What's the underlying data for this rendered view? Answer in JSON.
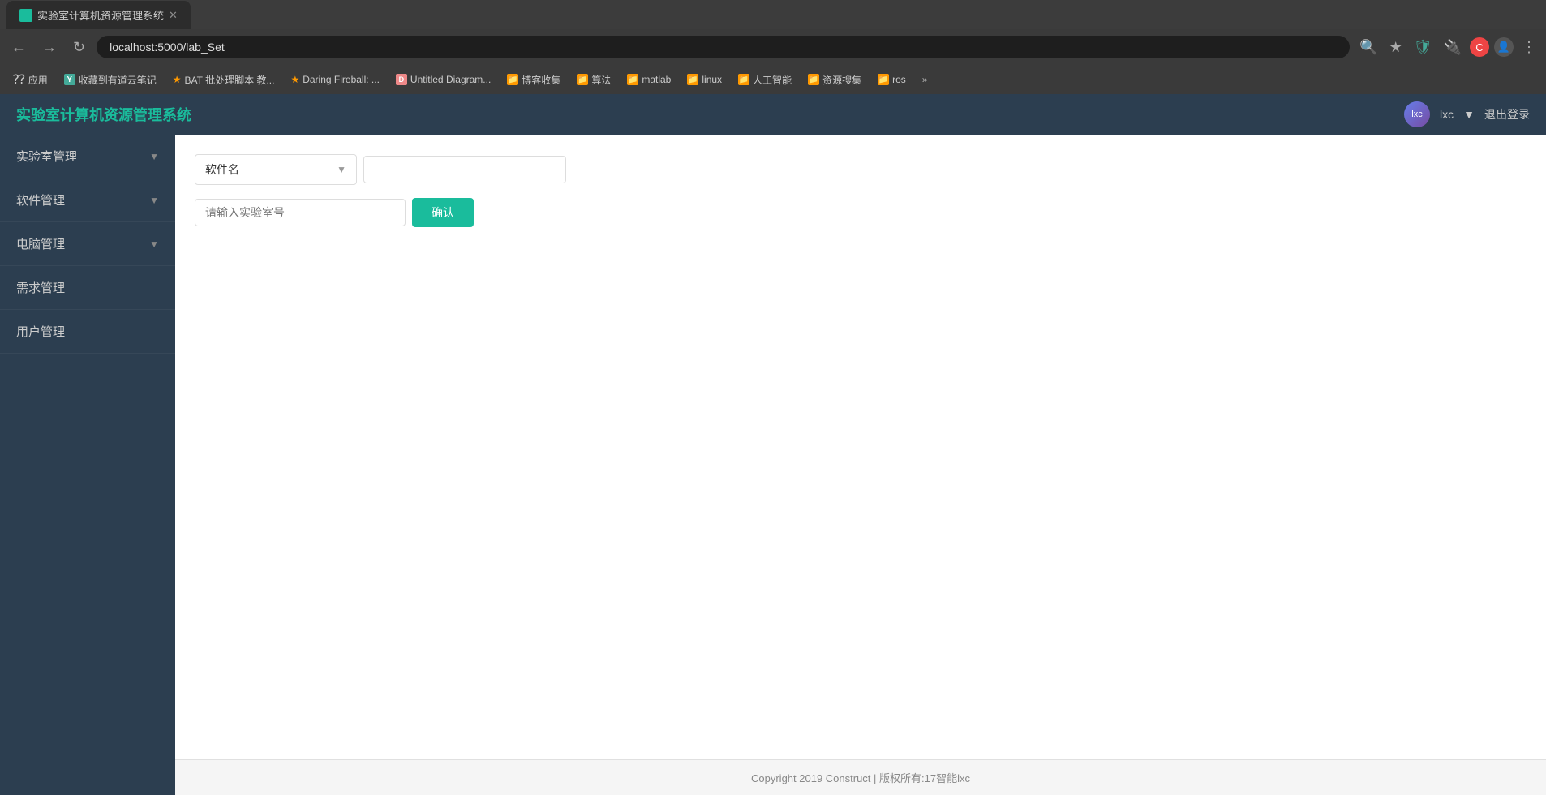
{
  "browser": {
    "url": "localhost:5000/lab_Set",
    "tab_title": "实验室计算机资源管理系统",
    "back_disabled": false,
    "forward_disabled": false
  },
  "bookmarks": [
    {
      "id": "apps",
      "label": "应用",
      "icon": "⋮⋮⋮",
      "type": "apps"
    },
    {
      "id": "youdao",
      "label": "收藏到有道云笔记",
      "icon": "📓",
      "color": "#4a9"
    },
    {
      "id": "bat",
      "label": "BAT 批处理脚本 教...",
      "icon": "★",
      "color": "#f90"
    },
    {
      "id": "daring",
      "label": "Daring Fireball: ...",
      "icon": "★",
      "color": "#f90"
    },
    {
      "id": "untitled",
      "label": "Untitled Diagram...",
      "icon": "📊",
      "color": "#e88"
    },
    {
      "id": "bokecollect",
      "label": "博客收集",
      "icon": "📁",
      "color": "#f90"
    },
    {
      "id": "algo",
      "label": "算法",
      "icon": "📁",
      "color": "#f90"
    },
    {
      "id": "matlab",
      "label": "matlab",
      "icon": "📁",
      "color": "#f90"
    },
    {
      "id": "linux",
      "label": "linux",
      "icon": "📁",
      "color": "#f90"
    },
    {
      "id": "ai",
      "label": "人工智能",
      "icon": "📁",
      "color": "#f90"
    },
    {
      "id": "resource",
      "label": "资源搜集",
      "icon": "📁",
      "color": "#f90"
    },
    {
      "id": "ros",
      "label": "ros",
      "icon": "📁",
      "color": "#f90"
    }
  ],
  "header": {
    "title": "实验室计算机资源管理系统",
    "user_name": "lxc",
    "logout_label": "退出登录",
    "user_dropdown": "▼"
  },
  "sidebar": {
    "items": [
      {
        "id": "lab-mgmt",
        "label": "实验室管理",
        "has_chevron": true
      },
      {
        "id": "software-mgmt",
        "label": "软件管理",
        "has_chevron": true
      },
      {
        "id": "computer-mgmt",
        "label": "电脑管理",
        "has_chevron": true
      },
      {
        "id": "demand-mgmt",
        "label": "需求管理",
        "has_chevron": false
      },
      {
        "id": "user-mgmt",
        "label": "用户管理",
        "has_chevron": false
      }
    ]
  },
  "filter": {
    "select_label": "软件名",
    "select_placeholder": "软件名",
    "text_input_value": "",
    "lab_input_placeholder": "请输入实验室号",
    "confirm_label": "确认"
  },
  "footer": {
    "text": "Copyright 2019 Construct  |  版权所有:17智能lxc"
  }
}
